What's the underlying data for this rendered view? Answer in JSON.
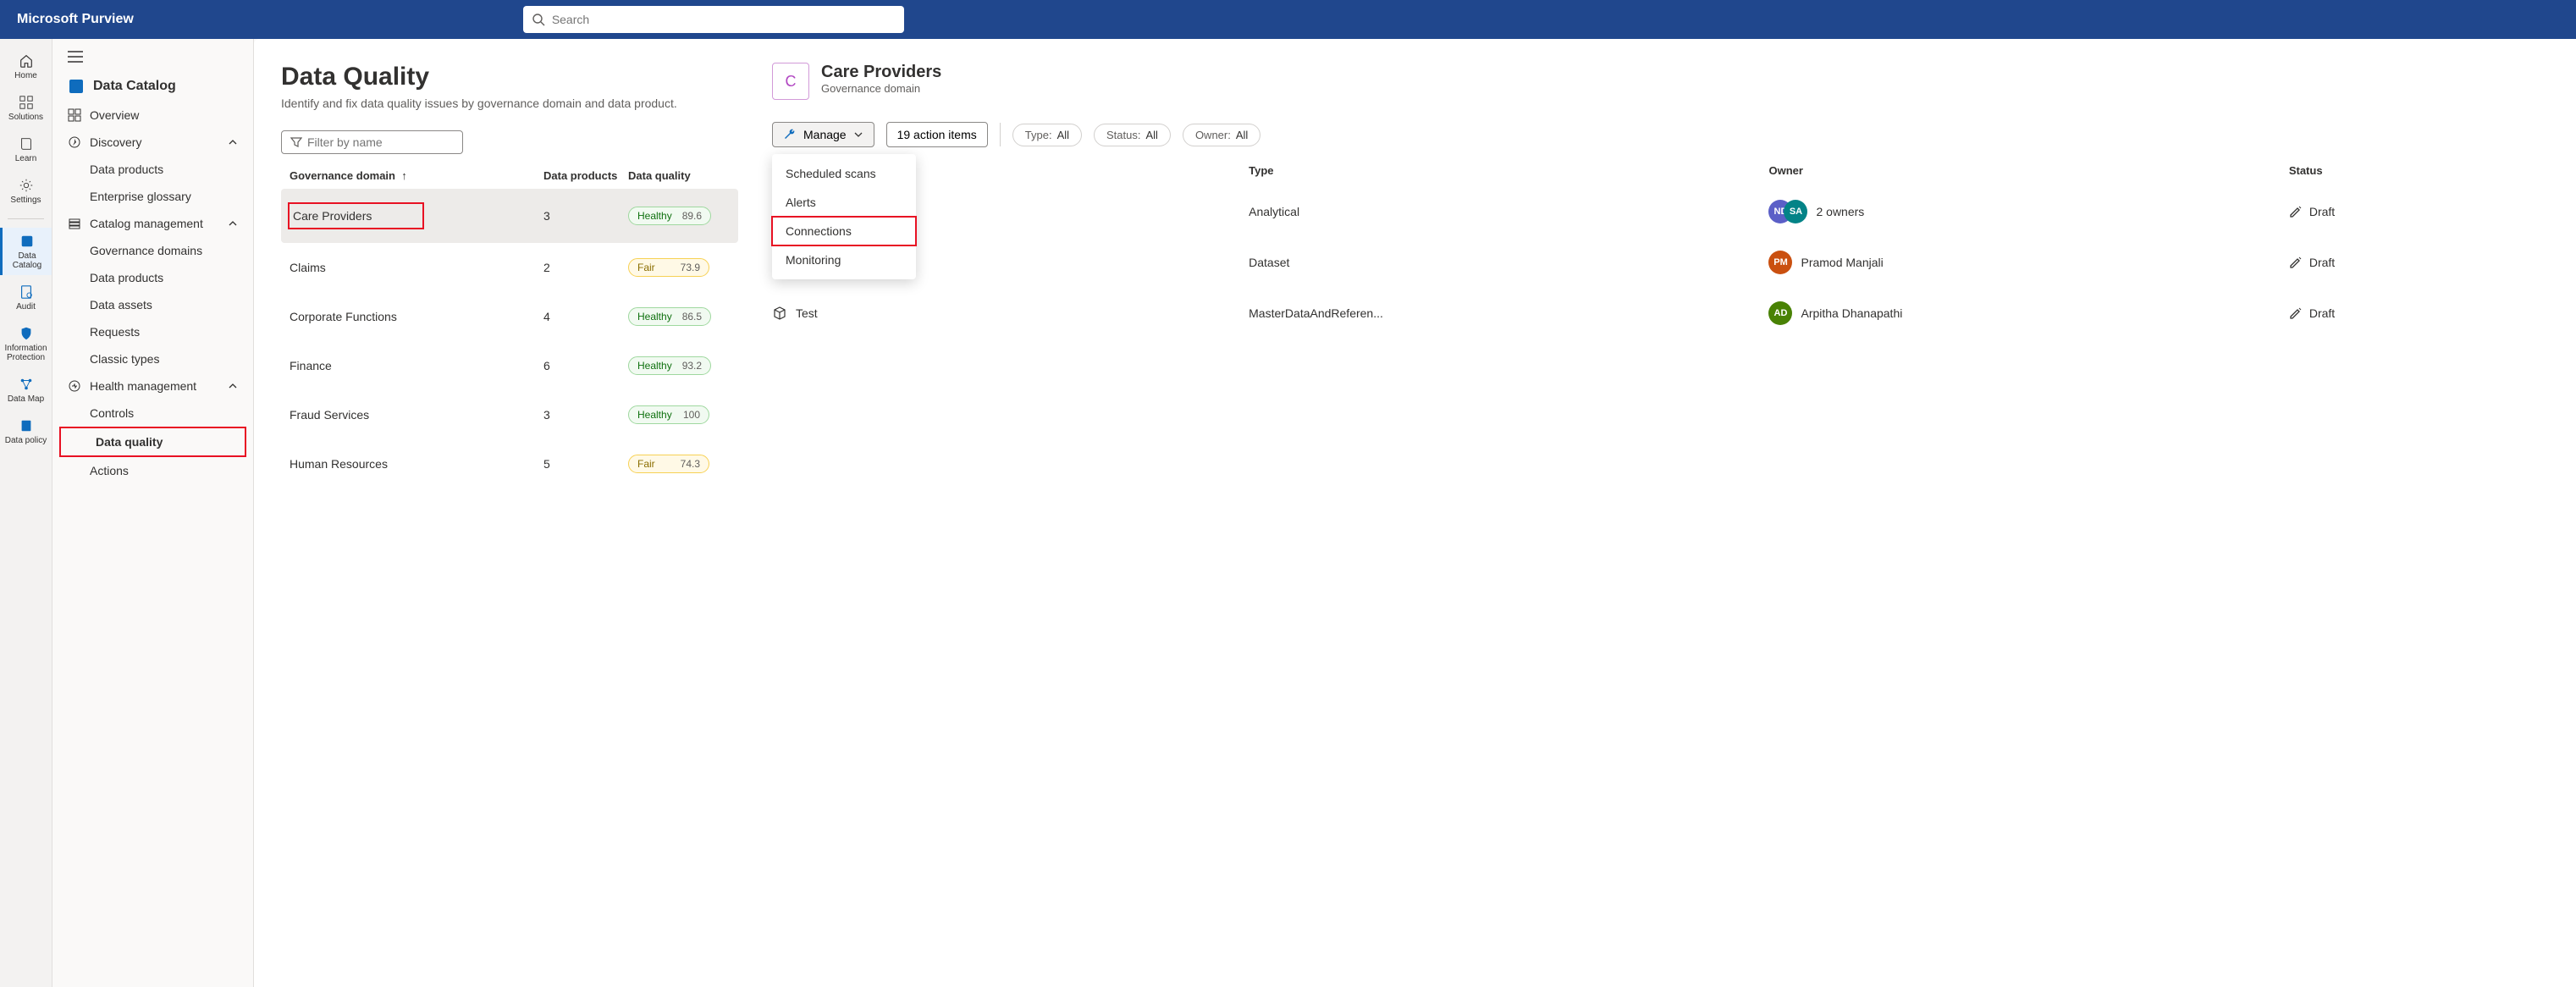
{
  "brand": "Microsoft Purview",
  "search": {
    "placeholder": "Search"
  },
  "rail": {
    "home": "Home",
    "solutions": "Solutions",
    "learn": "Learn",
    "settings": "Settings",
    "data_catalog": "Data Catalog",
    "audit": "Audit",
    "info_protection": "Information Protection",
    "data_map": "Data Map",
    "data_policy": "Data policy"
  },
  "sidebar": {
    "title": "Data Catalog",
    "overview": "Overview",
    "discovery": {
      "label": "Discovery",
      "data_products": "Data products",
      "enterprise_glossary": "Enterprise glossary"
    },
    "catalog_mgmt": {
      "label": "Catalog management",
      "governance_domains": "Governance domains",
      "data_products": "Data products",
      "data_assets": "Data assets",
      "requests": "Requests",
      "classic_types": "Classic types"
    },
    "health_mgmt": {
      "label": "Health management",
      "controls": "Controls",
      "data_quality": "Data quality",
      "actions": "Actions"
    }
  },
  "page": {
    "title": "Data Quality",
    "subtitle": "Identify and fix data quality issues by governance domain and data product.",
    "filter_placeholder": "Filter by name",
    "columns": {
      "gov": "Governance domain",
      "dp": "Data products",
      "dq": "Data quality"
    },
    "rows": [
      {
        "name": "Care Providers",
        "count": "3",
        "status": "Healthy",
        "score": "89.6",
        "selected": true,
        "highlight": true
      },
      {
        "name": "Claims",
        "count": "2",
        "status": "Fair",
        "score": "73.9"
      },
      {
        "name": "Corporate Functions",
        "count": "4",
        "status": "Healthy",
        "score": "86.5"
      },
      {
        "name": "Finance",
        "count": "6",
        "status": "Healthy",
        "score": "93.2"
      },
      {
        "name": "Fraud Services",
        "count": "3",
        "status": "Healthy",
        "score": "100"
      },
      {
        "name": "Human Resources",
        "count": "5",
        "status": "Fair",
        "score": "74.3"
      }
    ]
  },
  "detail": {
    "badge_letter": "C",
    "title": "Care Providers",
    "subtitle": "Governance domain",
    "manage_label": "Manage",
    "actions_label": "19 action items",
    "manage_menu": {
      "scheduled_scans": "Scheduled scans",
      "alerts": "Alerts",
      "connections": "Connections",
      "monitoring": "Monitoring"
    },
    "chips": {
      "type_k": "Type: ",
      "type_v": "All",
      "status_k": "Status: ",
      "status_v": "All",
      "owner_k": "Owner: ",
      "owner_v": "All"
    },
    "columns": {
      "type": "Type",
      "owner": "Owner",
      "status": "Status"
    },
    "rows": [
      {
        "name_hidden": "",
        "type": "Analytical",
        "owner_text": "2 owners",
        "avatars": [
          "ND",
          "SA"
        ],
        "status": "Draft"
      },
      {
        "name_hidden": "",
        "type": "Dataset",
        "owner_text": "Pramod Manjali",
        "avatars": [
          "PM"
        ],
        "status": "Draft"
      },
      {
        "name": "Test",
        "type": "MasterDataAndReferen...",
        "owner_text": "Arpitha Dhanapathi",
        "avatars": [
          "AD"
        ],
        "status": "Draft"
      }
    ]
  }
}
